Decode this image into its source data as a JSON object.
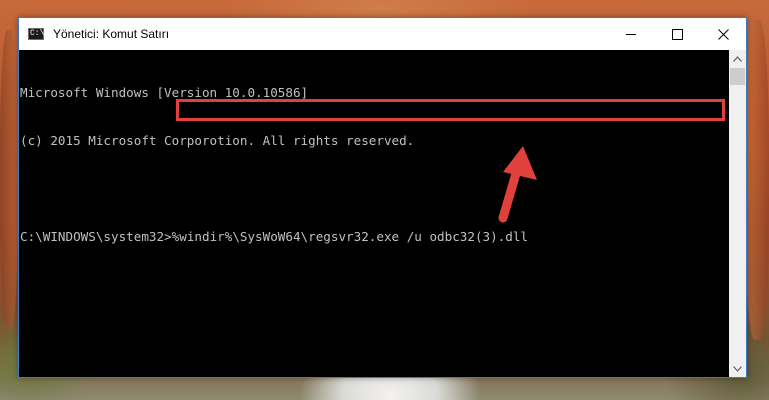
{
  "window": {
    "title": "Yönetici: Komut Satırı",
    "icon": "cmd-icon",
    "icon_glyph": "C:\\",
    "controls": {
      "minimize": "minimize-icon",
      "maximize": "maximize-icon",
      "close": "close-icon"
    }
  },
  "console": {
    "lines": [
      "Microsoft Windows [Version 10.0.10586]",
      "(c) 2015 Microsoft Corporotion. All rights reserved.",
      ""
    ],
    "prompt": "C:\\WINDOWS\\system32>",
    "command": "%windir%\\SysWoW64\\regsvr32.exe /u odbc32(3).dll",
    "text_color": "#c0c0c0",
    "background": "#000000"
  },
  "annotation": {
    "highlight_color": "#e0413a",
    "arrow_icon": "arrow-up-icon"
  }
}
